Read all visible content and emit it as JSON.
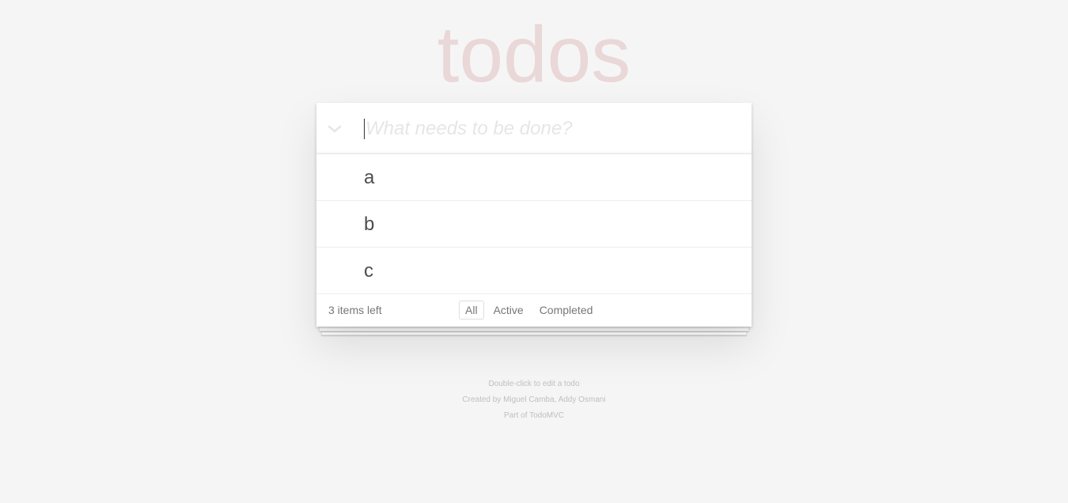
{
  "app": {
    "title": "todos"
  },
  "new_todo": {
    "placeholder": "What needs to be done?",
    "value": ""
  },
  "toggle_all": {
    "icon": "chevron-down-icon"
  },
  "todos": [
    {
      "label": "a",
      "completed": false
    },
    {
      "label": "b",
      "completed": false
    },
    {
      "label": "c",
      "completed": false
    }
  ],
  "footer": {
    "count": "3 items left",
    "filters": [
      {
        "label": "All",
        "selected": true
      },
      {
        "label": "Active",
        "selected": false
      },
      {
        "label": "Completed",
        "selected": false
      }
    ]
  },
  "info": {
    "hint": "Double-click to edit a todo",
    "credits": "Created by Miguel Camba, Addy Osmani",
    "part_of": "Part of TodoMVC"
  },
  "colors": {
    "background": "#f5f5f5",
    "title": "#ead7d7",
    "text": "#4d4d4d",
    "muted": "#777777",
    "info": "#bfbfbf"
  }
}
